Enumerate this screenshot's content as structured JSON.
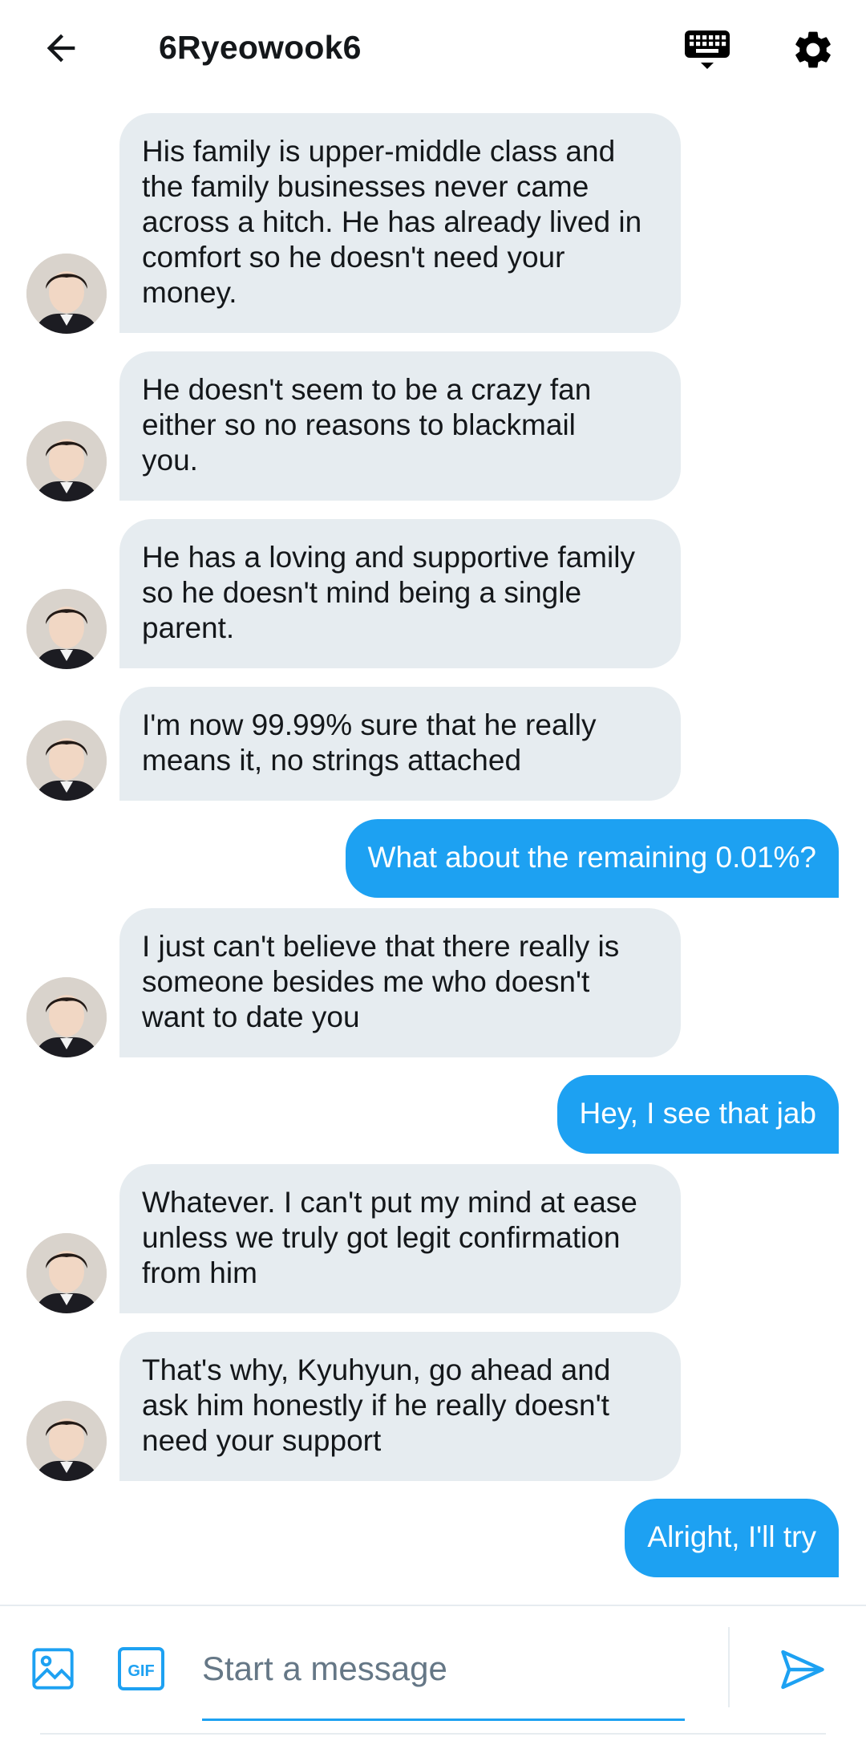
{
  "header": {
    "title": "6Ryeowook6",
    "back_icon": "arrow-left-icon",
    "keyboard_icon": "keyboard-icon",
    "settings_icon": "gear-icon"
  },
  "messages": [
    {
      "side": "in",
      "text": "His family is upper-middle class and\nthe family businesses never came\nacross a hitch. He has already lived in\ncomfort so he doesn't need your\nmoney."
    },
    {
      "side": "in",
      "text": "He doesn't seem to be a crazy fan\neither so no reasons to blackmail\nyou."
    },
    {
      "side": "in",
      "text": "He has a loving and supportive family\nso he doesn't mind being a single\nparent."
    },
    {
      "side": "in",
      "text": "I'm now 99.99% sure that he really\nmeans it, no strings attached"
    },
    {
      "side": "out",
      "text": "What about the remaining 0.01%?"
    },
    {
      "side": "in",
      "text": "I just can't believe that there really is\nsomeone besides me who doesn't\nwant to date you"
    },
    {
      "side": "out",
      "text": "Hey, I see that jab"
    },
    {
      "side": "in",
      "text": "Whatever. I can't put my mind at ease\nunless we truly got legit confirmation\nfrom him"
    },
    {
      "side": "in",
      "text": "That's why, Kyuhyun, go ahead and\nask him honestly if he really doesn't\nneed your support"
    },
    {
      "side": "out",
      "text": "Alright, I'll try"
    }
  ],
  "composer": {
    "placeholder": "Start a message",
    "image_icon": "image-icon",
    "gif_label": "GIF",
    "send_icon": "send-icon"
  },
  "colors": {
    "accent": "#1da1f2",
    "incoming_bubble": "#e6ecf0",
    "text": "#14171a",
    "placeholder": "#657786"
  }
}
